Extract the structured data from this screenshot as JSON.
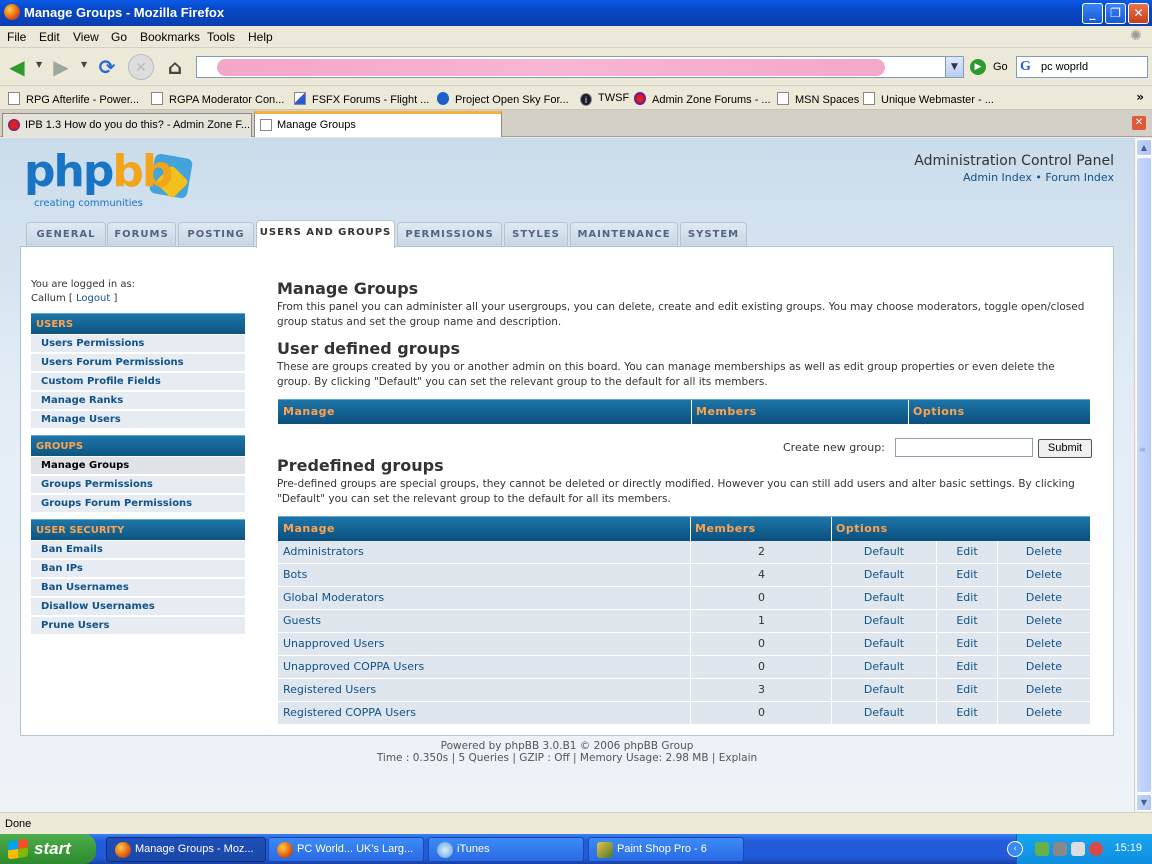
{
  "window": {
    "title": "Manage Groups - Mozilla Firefox",
    "min": "_",
    "max": "❐",
    "close": "✕"
  },
  "menubar": [
    "File",
    "Edit",
    "View",
    "Go",
    "Bookmarks",
    "Tools",
    "Help"
  ],
  "navbar": {
    "go_label": "Go",
    "search_value": "pc woprld",
    "search_logo": "G"
  },
  "bookmarks": [
    {
      "label": "RPG Afterlife - Power...",
      "icon": "page-icon"
    },
    {
      "label": "RGPA Moderator Con...",
      "icon": "page-icon"
    },
    {
      "label": "FSFX Forums - Flight ...",
      "icon": "forum-icon"
    },
    {
      "label": "Project Open Sky For...",
      "icon": "globe-icon"
    },
    {
      "label": "TWSF",
      "icon": "info-icon"
    },
    {
      "label": "Admin Zone Forums - ...",
      "icon": "adminzone-icon"
    },
    {
      "label": "MSN Spaces",
      "icon": "page-icon"
    },
    {
      "label": "Unique Webmaster - ...",
      "icon": "page-icon"
    }
  ],
  "browser_tabs": [
    {
      "label": "IPB 1.3 How do you do this? - Admin Zone F...",
      "active": false
    },
    {
      "label": "Manage Groups",
      "active": true
    }
  ],
  "header": {
    "logo_php": "php",
    "logo_bb": "bb",
    "logo_tagline": "creating communities",
    "acp_title": "Administration Control Panel",
    "admin_index": "Admin Index",
    "sep": "•",
    "forum_index": "Forum Index"
  },
  "main_tabs": [
    "GENERAL",
    "FORUMS",
    "POSTING",
    "USERS AND GROUPS",
    "PERMISSIONS",
    "STYLES",
    "MAINTENANCE",
    "SYSTEM"
  ],
  "sidebar": {
    "logged_in_as": "You are logged in as:",
    "username": "Callum",
    "logout": "Logout",
    "sections": [
      {
        "title": "USERS",
        "items": [
          "Users Permissions",
          "Users Forum Permissions",
          "Custom Profile Fields",
          "Manage Ranks",
          "Manage Users"
        ]
      },
      {
        "title": "GROUPS",
        "items": [
          "Manage Groups",
          "Groups Permissions",
          "Groups Forum Permissions"
        ]
      },
      {
        "title": "USER SECURITY",
        "items": [
          "Ban Emails",
          "Ban IPs",
          "Ban Usernames",
          "Disallow Usernames",
          "Prune Users"
        ]
      }
    ]
  },
  "main": {
    "title": "Manage Groups",
    "description": "From this panel you can administer all your usergroups, you can delete, create and edit existing groups. You may choose moderators, toggle open/closed group status and set the group name and description.",
    "user_defined": {
      "title": "User defined groups",
      "description": "These are groups created by you or another admin on this board. You can manage memberships as well as edit group properties or even delete the group. By clicking \"Default\" you can set the relevant group to the default for all its members.",
      "headers": [
        "Manage",
        "Members",
        "Options"
      ]
    },
    "create_label": "Create new group:",
    "create_value": "",
    "submit": "Submit",
    "predefined": {
      "title": "Predefined groups",
      "description": "Pre-defined groups are special groups, they cannot be deleted or directly modified. However you can still add users and alter basic settings. By clicking \"Default\" you can set the relevant group to the default for all its members.",
      "headers": [
        "Manage",
        "Members",
        "Options"
      ],
      "rows": [
        {
          "name": "Administrators",
          "members": "2",
          "default": "Default",
          "edit": "Edit",
          "delete": "Delete"
        },
        {
          "name": "Bots",
          "members": "4",
          "default": "Default",
          "edit": "Edit",
          "delete": "Delete"
        },
        {
          "name": "Global Moderators",
          "members": "0",
          "default": "Default",
          "edit": "Edit",
          "delete": "Delete"
        },
        {
          "name": "Guests",
          "members": "1",
          "default": "Default",
          "edit": "Edit",
          "delete": "Delete"
        },
        {
          "name": "Unapproved Users",
          "members": "0",
          "default": "Default",
          "edit": "Edit",
          "delete": "Delete"
        },
        {
          "name": "Unapproved COPPA Users",
          "members": "0",
          "default": "Default",
          "edit": "Edit",
          "delete": "Delete"
        },
        {
          "name": "Registered Users",
          "members": "3",
          "default": "Default",
          "edit": "Edit",
          "delete": "Delete"
        },
        {
          "name": "Registered COPPA Users",
          "members": "0",
          "default": "Default",
          "edit": "Edit",
          "delete": "Delete"
        }
      ]
    }
  },
  "footer": {
    "powered": "Powered by phpBB 3.0.B1 © 2006 phpBB Group",
    "stats": "Time : 0.350s | 5 Queries | GZIP : Off | Memory Usage: 2.98 MB | Explain"
  },
  "statusbar": "Done",
  "taskbar": {
    "start": "start",
    "tasks": [
      {
        "label": "Manage Groups - Moz...",
        "active": true
      },
      {
        "label": "PC World... UK's Larg...",
        "active": false
      },
      {
        "label": "iTunes",
        "active": false
      },
      {
        "label": "Paint Shop Pro - 6",
        "active": false
      }
    ],
    "clock": "15:19"
  },
  "colors": {
    "link": "#105289",
    "header_orange": "#ffa34f",
    "table_blue": "#0d5582"
  }
}
